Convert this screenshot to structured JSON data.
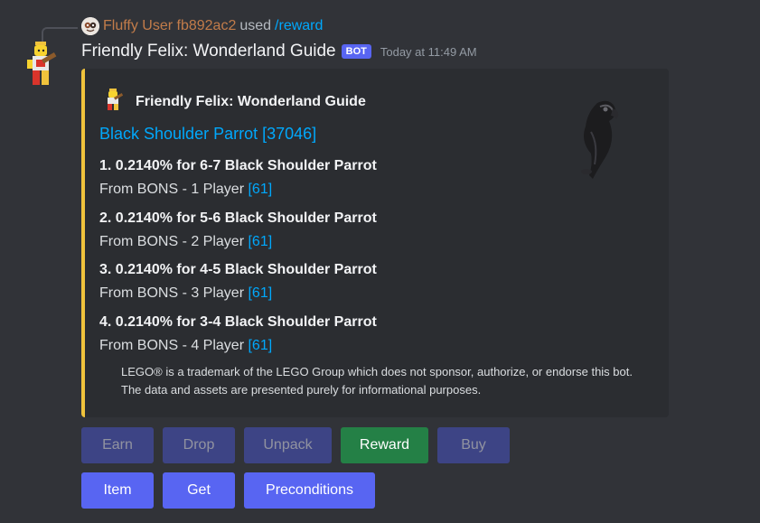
{
  "reply": {
    "user": "Fluffy User fb892ac2",
    "used": "used",
    "command": "/reward"
  },
  "message": {
    "bot_name": "Friendly Felix: Wonderland Guide",
    "bot_tag": "BOT",
    "timestamp": "Today at 11:49 AM"
  },
  "embed": {
    "accent_color": "#f0c33c",
    "author": "Friendly Felix: Wonderland Guide",
    "title": "Black Shoulder Parrot [37046]",
    "fields": [
      {
        "name": "1. 0.2140% for 6-7 Black Shoulder Parrot",
        "value": "From BONS - 1 Player",
        "link": "[61]"
      },
      {
        "name": "2. 0.2140% for 5-6 Black Shoulder Parrot",
        "value": "From BONS - 2 Player",
        "link": "[61]"
      },
      {
        "name": "3. 0.2140% for 4-5 Black Shoulder Parrot",
        "value": "From BONS - 3 Player",
        "link": "[61]"
      },
      {
        "name": "4. 0.2140% for 3-4 Black Shoulder Parrot",
        "value": "From BONS - 4 Player",
        "link": "[61]"
      }
    ],
    "footer": "LEGO® is a trademark of the LEGO Group which does not sponsor, authorize, or endorse this bot. The data and assets are presented purely for informational purposes."
  },
  "buttons": {
    "row1": [
      {
        "label": "Earn",
        "state": "disabled"
      },
      {
        "label": "Drop",
        "state": "disabled"
      },
      {
        "label": "Unpack",
        "state": "disabled"
      },
      {
        "label": "Reward",
        "state": "success"
      },
      {
        "label": "Buy",
        "state": "disabled"
      }
    ],
    "row2": [
      {
        "label": "Item",
        "state": "primary"
      },
      {
        "label": "Get",
        "state": "primary"
      },
      {
        "label": "Preconditions",
        "state": "primary"
      }
    ]
  },
  "colors": {
    "background": "#313338",
    "embed_bg": "#2b2d31",
    "link": "#00a8fc",
    "blurple": "#5865f2",
    "green": "#248046"
  },
  "icons": {
    "reply_avatar": "user-avatar-icon",
    "bot_avatar": "minifigure-avatar-icon",
    "author_icon": "minifigure-icon",
    "thumbnail": "parrot-icon"
  }
}
